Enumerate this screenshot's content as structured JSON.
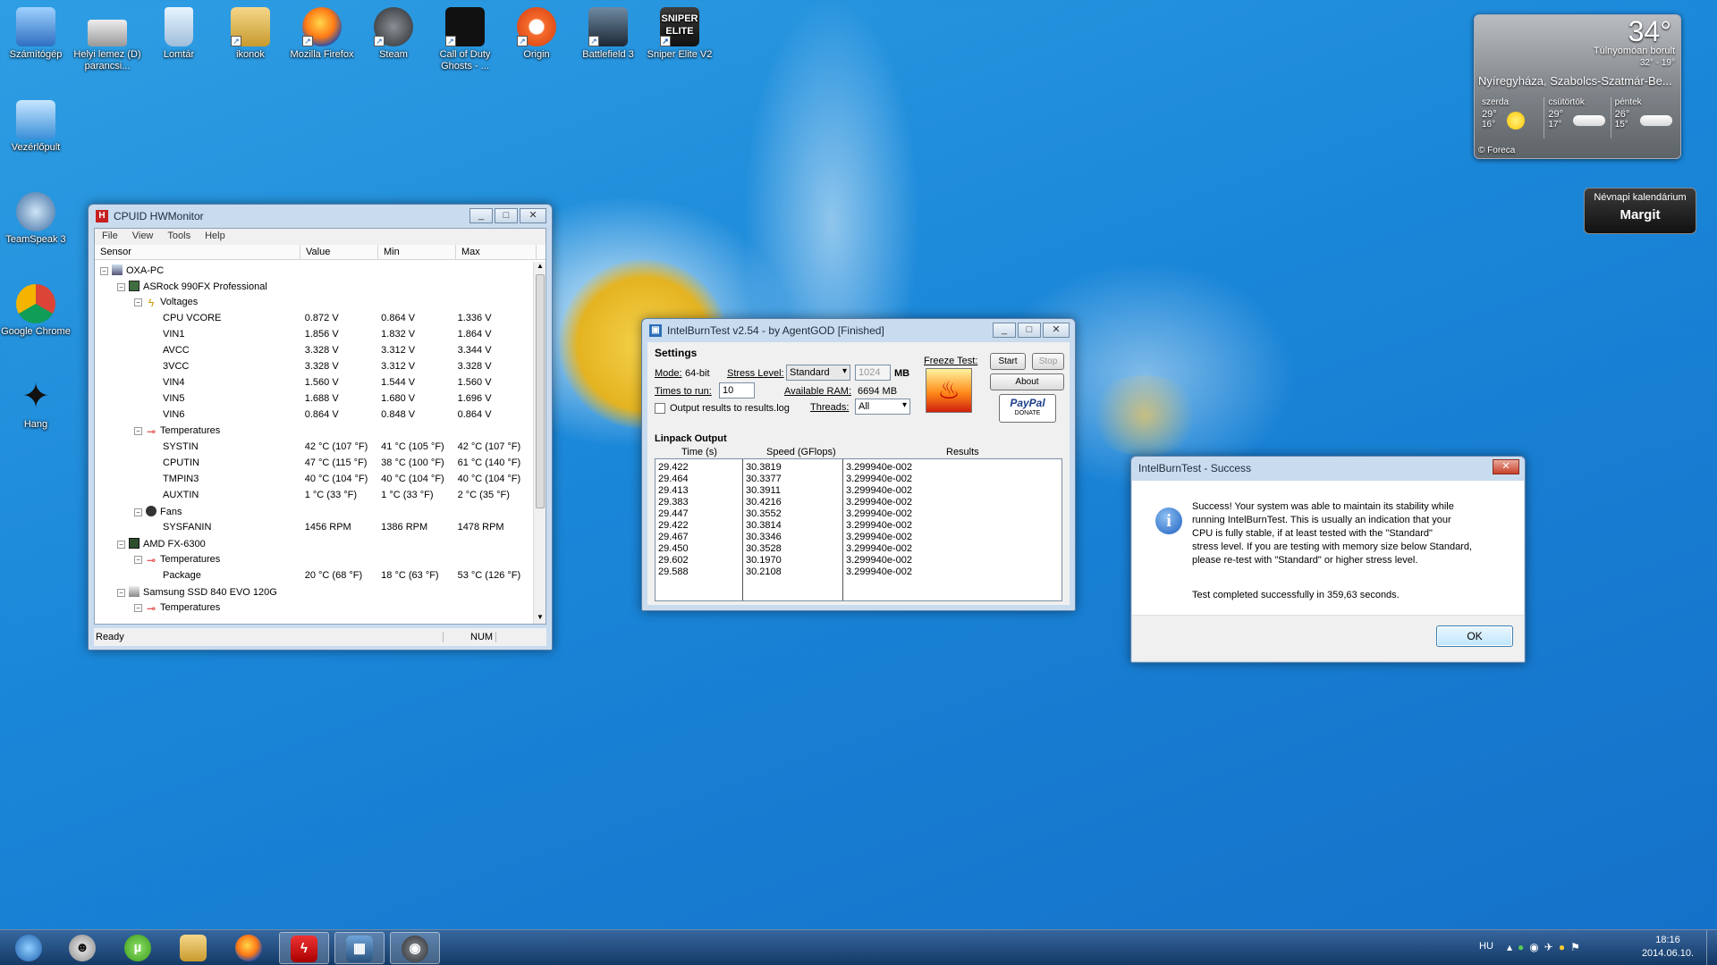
{
  "desktop_icons": [
    {
      "label": "Számítógép",
      "icon": "computer-icon"
    },
    {
      "label": "Helyi lemez (D) parancsi...",
      "icon": "drive-icon"
    },
    {
      "label": "Lomtár",
      "icon": "recycle-bin-icon"
    },
    {
      "label": "ikonok",
      "icon": "folder-icon"
    },
    {
      "label": "Mozilla Firefox",
      "icon": "firefox-icon"
    },
    {
      "label": "Steam",
      "icon": "steam-icon"
    },
    {
      "label": "Call of Duty Ghosts - ...",
      "icon": "cod-icon"
    },
    {
      "label": "Origin",
      "icon": "origin-icon"
    },
    {
      "label": "Battlefield 3",
      "icon": "battlefield-icon"
    },
    {
      "label": "Sniper Elite V2",
      "icon": "sniper-elite-icon"
    },
    {
      "label": "Vezérlőpult",
      "icon": "control-panel-icon"
    },
    {
      "label": "TeamSpeak 3",
      "icon": "teamspeak-icon"
    },
    {
      "label": "Google Chrome",
      "icon": "chrome-icon"
    },
    {
      "label": "Hang",
      "icon": "sound-icon"
    }
  ],
  "sniper_logo_text": [
    "SNIPER",
    "ELITE"
  ],
  "hwmonitor": {
    "title": "CPUID HWMonitor",
    "menu": [
      "File",
      "View",
      "Tools",
      "Help"
    ],
    "columns": [
      "Sensor",
      "Value",
      "Min",
      "Max"
    ],
    "rows": [
      {
        "indent": 0,
        "toggle": "-",
        "icon": "computer-node-icon",
        "name": "OXA-PC",
        "value": "",
        "min": "",
        "max": ""
      },
      {
        "indent": 1,
        "toggle": "-",
        "icon": "motherboard-icon",
        "name": "ASRock 990FX Professional",
        "value": "",
        "min": "",
        "max": ""
      },
      {
        "indent": 2,
        "toggle": "-",
        "icon": "voltage-icon",
        "name": "Voltages",
        "value": "",
        "min": "",
        "max": ""
      },
      {
        "indent": 3,
        "toggle": "",
        "icon": "",
        "name": "CPU VCORE",
        "value": "0.872 V",
        "min": "0.864 V",
        "max": "1.336 V"
      },
      {
        "indent": 3,
        "toggle": "",
        "icon": "",
        "name": "VIN1",
        "value": "1.856 V",
        "min": "1.832 V",
        "max": "1.864 V"
      },
      {
        "indent": 3,
        "toggle": "",
        "icon": "",
        "name": "AVCC",
        "value": "3.328 V",
        "min": "3.312 V",
        "max": "3.344 V"
      },
      {
        "indent": 3,
        "toggle": "",
        "icon": "",
        "name": "3VCC",
        "value": "3.328 V",
        "min": "3.312 V",
        "max": "3.328 V"
      },
      {
        "indent": 3,
        "toggle": "",
        "icon": "",
        "name": "VIN4",
        "value": "1.560 V",
        "min": "1.544 V",
        "max": "1.560 V"
      },
      {
        "indent": 3,
        "toggle": "",
        "icon": "",
        "name": "VIN5",
        "value": "1.688 V",
        "min": "1.680 V",
        "max": "1.696 V"
      },
      {
        "indent": 3,
        "toggle": "",
        "icon": "",
        "name": "VIN6",
        "value": "0.864 V",
        "min": "0.848 V",
        "max": "0.864 V"
      },
      {
        "indent": 2,
        "toggle": "-",
        "icon": "thermometer-icon",
        "name": "Temperatures",
        "value": "",
        "min": "",
        "max": ""
      },
      {
        "indent": 3,
        "toggle": "",
        "icon": "",
        "name": "SYSTIN",
        "value": "42 °C (107 °F)",
        "min": "41 °C (105 °F)",
        "max": "42 °C (107 °F)"
      },
      {
        "indent": 3,
        "toggle": "",
        "icon": "",
        "name": "CPUTIN",
        "value": "47 °C (115 °F)",
        "min": "38 °C (100 °F)",
        "max": "61 °C (140 °F)"
      },
      {
        "indent": 3,
        "toggle": "",
        "icon": "",
        "name": "TMPIN3",
        "value": "40 °C (104 °F)",
        "min": "40 °C (104 °F)",
        "max": "40 °C (104 °F)"
      },
      {
        "indent": 3,
        "toggle": "",
        "icon": "",
        "name": "AUXTIN",
        "value": "1 °C (33 °F)",
        "min": "1 °C (33 °F)",
        "max": "2 °C (35 °F)"
      },
      {
        "indent": 2,
        "toggle": "-",
        "icon": "fan-icon",
        "name": "Fans",
        "value": "",
        "min": "",
        "max": ""
      },
      {
        "indent": 3,
        "toggle": "",
        "icon": "",
        "name": "SYSFANIN",
        "value": "1456 RPM",
        "min": "1386 RPM",
        "max": "1478 RPM"
      },
      {
        "indent": 1,
        "toggle": "-",
        "icon": "cpu-icon",
        "name": "AMD FX-6300",
        "value": "",
        "min": "",
        "max": ""
      },
      {
        "indent": 2,
        "toggle": "-",
        "icon": "thermometer-icon",
        "name": "Temperatures",
        "value": "",
        "min": "",
        "max": ""
      },
      {
        "indent": 3,
        "toggle": "",
        "icon": "",
        "name": "Package",
        "value": "20 °C (68 °F)",
        "min": "18 °C (63 °F)",
        "max": "53 °C (126 °F)"
      },
      {
        "indent": 1,
        "toggle": "-",
        "icon": "ssd-icon",
        "name": "Samsung SSD 840 EVO 120G",
        "value": "",
        "min": "",
        "max": ""
      },
      {
        "indent": 2,
        "toggle": "-",
        "icon": "thermometer-icon",
        "name": "Temperatures",
        "value": "",
        "min": "",
        "max": ""
      }
    ],
    "status": {
      "text": "Ready",
      "num": "NUM"
    }
  },
  "ibt": {
    "title": "IntelBurnTest v2.54 - by AgentGOD [Finished]",
    "settings_label": "Settings",
    "mode_label": "Mode:",
    "mode_value": "64-bit",
    "stress_label": "Stress Level:",
    "stress_value": "Standard",
    "mem_value": "1024",
    "mem_unit": "MB",
    "times_label": "Times to run:",
    "times_value": "10",
    "ram_label": "Available RAM:",
    "ram_value": "6694 MB",
    "threads_label": "Threads:",
    "threads_value": "All",
    "log_label": "Output results to results.log",
    "freeze_label": "Freeze Test:",
    "start_label": "Start",
    "stop_label": "Stop",
    "about_label": "About",
    "paypal_label": "PayPal",
    "donate_label": "DONATE",
    "output_label": "Linpack Output",
    "col_time": "Time (s)",
    "col_speed": "Speed (GFlops)",
    "col_results": "Results",
    "times": "29.422\n29.464\n29.413\n29.383\n29.447\n29.422\n29.467\n29.450\n29.602\n29.588",
    "speeds": "30.3819\n30.3377\n30.3911\n30.4216\n30.3552\n30.3814\n30.3346\n30.3528\n30.1970\n30.2108",
    "results": "3.299940e-002\n3.299940e-002\n3.299940e-002\n3.299940e-002\n3.299940e-002\n3.299940e-002\n3.299940e-002\n3.299940e-002\n3.299940e-002\n3.299940e-002"
  },
  "dialog": {
    "title": "IntelBurnTest - Success",
    "message": "Success! Your system was able to maintain its stability while\nrunning IntelBurnTest. This is usually an indication that your\nCPU is fully stable, if at least tested with the \"Standard\"\nstress level. If you are testing with memory size below Standard,\nplease re-test with \"Standard\" or higher stress level.",
    "completed": "Test completed successfully in 359,63 seconds.",
    "ok_label": "OK"
  },
  "weather": {
    "temp": "34°",
    "condition": "Túlnyomóan borult",
    "range": "32° - 19°",
    "location": "Nyíregyháza, Szabolcs-Szatmár-Be...",
    "forecast": [
      {
        "day": "szerda",
        "hi": "29°",
        "lo": "16°",
        "icon": "sun-icon"
      },
      {
        "day": "csütörtök",
        "hi": "29°",
        "lo": "17°",
        "icon": "cloud-icon"
      },
      {
        "day": "péntek",
        "hi": "26°",
        "lo": "15°",
        "icon": "cloud-icon"
      }
    ],
    "credit": "© Foreca"
  },
  "nevnap": {
    "title": "Névnapi kalendárium",
    "name": "Margit"
  },
  "taskbar": {
    "items": [
      {
        "name": "start-button",
        "icon": "windows-orb-icon"
      },
      {
        "name": "taskbar-alien",
        "icon": "alien-icon"
      },
      {
        "name": "taskbar-utorrent",
        "icon": "utorrent-icon"
      },
      {
        "name": "taskbar-explorer",
        "icon": "folder-icon"
      },
      {
        "name": "taskbar-firefox",
        "icon": "firefox-icon"
      },
      {
        "name": "taskbar-ibt",
        "icon": "burn-icon"
      },
      {
        "name": "taskbar-cpuz",
        "icon": "cpu-icon"
      },
      {
        "name": "taskbar-steam",
        "icon": "steam-icon"
      }
    ],
    "language": "HU",
    "time": "18:16",
    "date": "2014.06.10."
  }
}
